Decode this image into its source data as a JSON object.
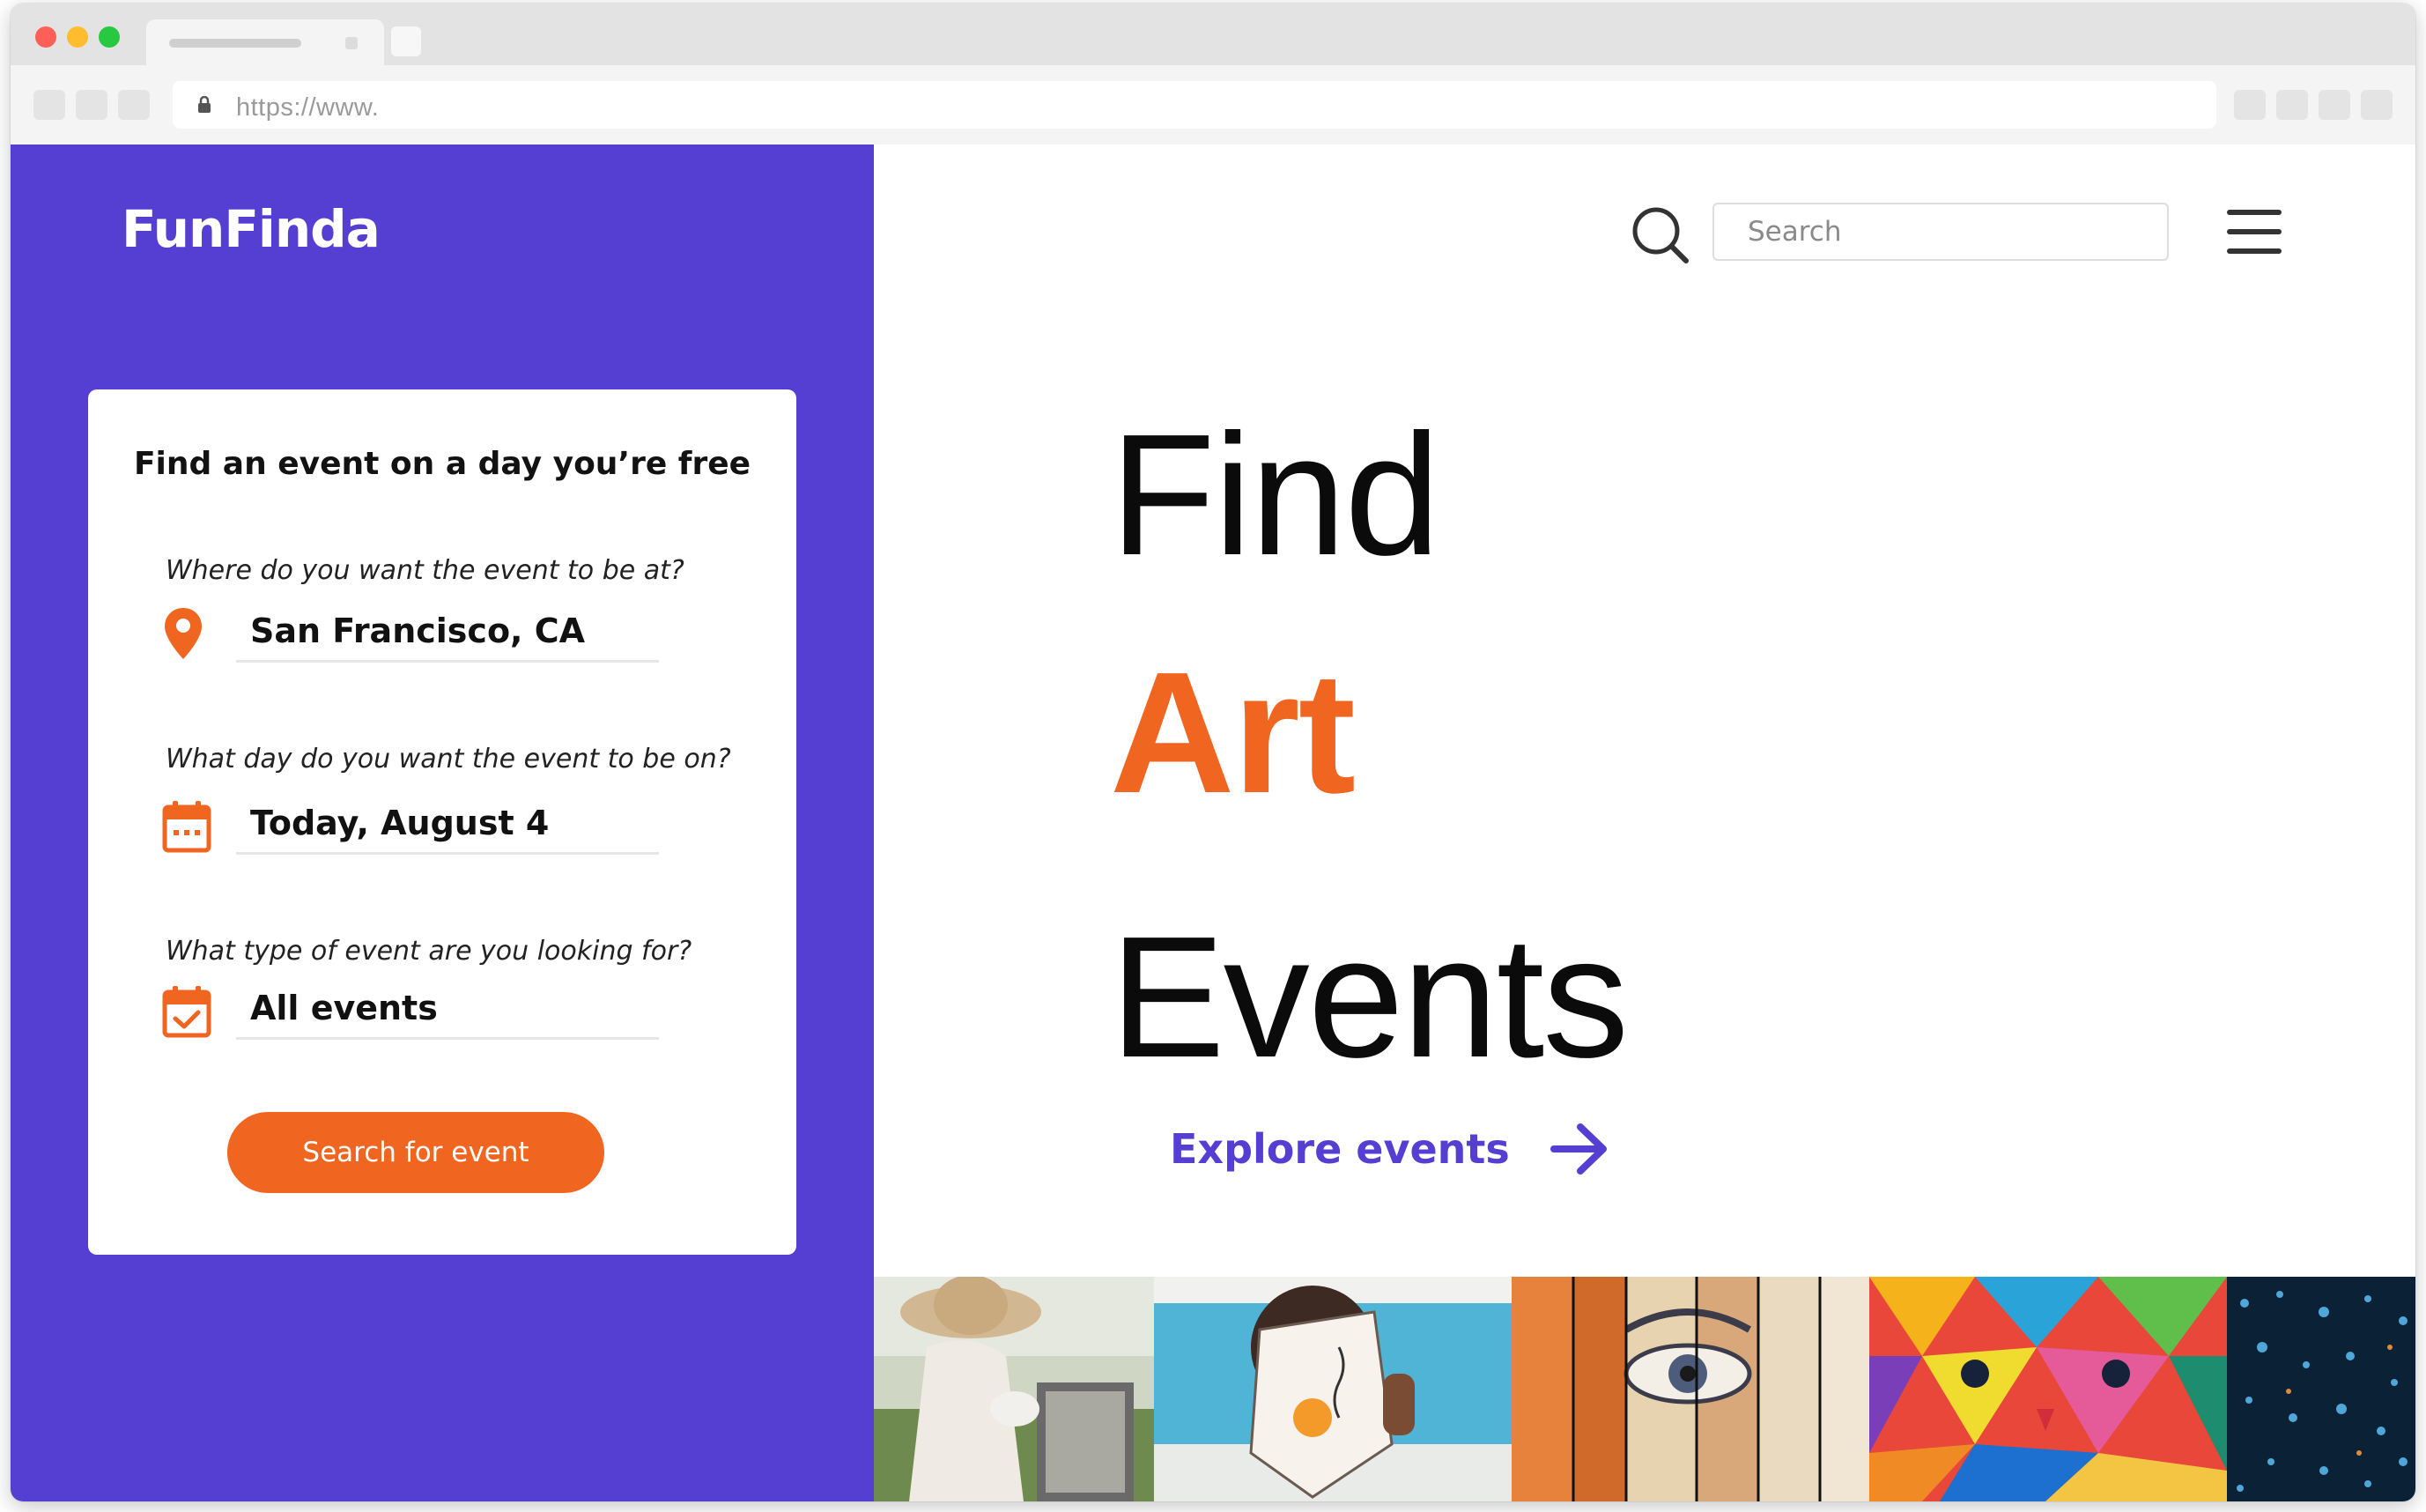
{
  "browser": {
    "url": "https://www."
  },
  "brand": {
    "logo": "FunFinda",
    "accent": "#553fd3",
    "highlight": "#f06621"
  },
  "finder": {
    "title": "Find an event on a day you’re free",
    "location": {
      "question": "Where do you want the event to be at?",
      "value": "San Francisco, CA",
      "icon": "map-pin-icon"
    },
    "date": {
      "question": "What day do you want the event to be on?",
      "value": "Today, August 4",
      "icon": "calendar-icon"
    },
    "type": {
      "question": "What type of event are you looking for?",
      "value": "All events",
      "icon": "calendar-check-icon"
    },
    "button": "Search for event"
  },
  "header": {
    "search_placeholder": "Search",
    "search_icon": "search-icon",
    "menu_icon": "hamburger-menu-icon"
  },
  "hero": {
    "line1": "Find",
    "line2": "Art",
    "line3": "Events",
    "cta": "Explore events",
    "cta_icon": "arrow-right-icon"
  },
  "gallery": [
    {
      "name": "painter-in-field"
    },
    {
      "name": "abstract-painting-held"
    },
    {
      "name": "fence-mural"
    },
    {
      "name": "geometric-lion-mural"
    },
    {
      "name": "light-installation"
    }
  ]
}
